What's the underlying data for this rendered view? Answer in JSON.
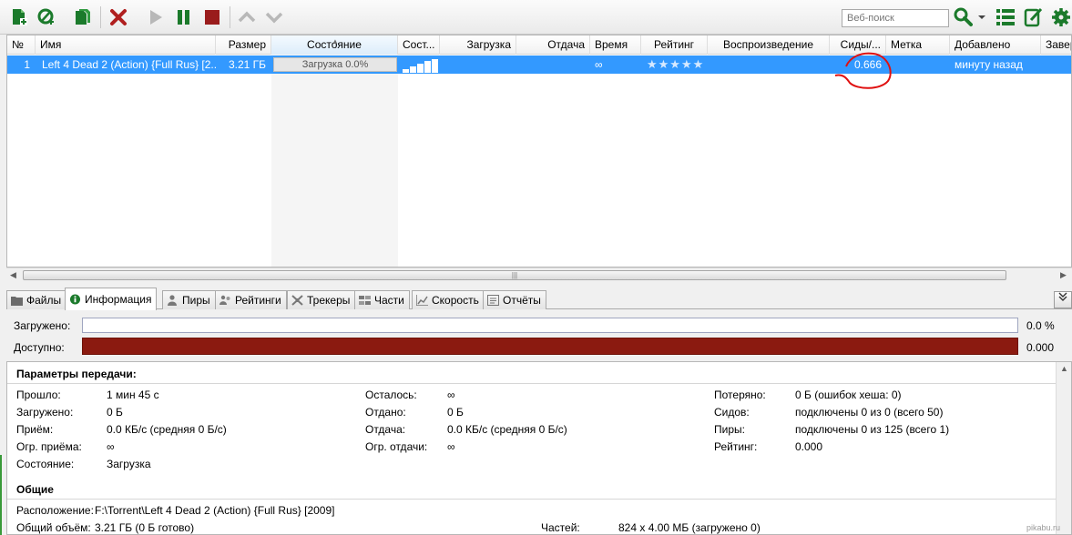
{
  "toolbar": {
    "search_placeholder": "Веб-поиск",
    "icons": [
      "add-torrent-icon",
      "add-link-icon",
      "create-torrent-icon",
      "remove-icon",
      "start-icon",
      "pause-icon",
      "stop-icon",
      "move-up-icon",
      "move-down-icon",
      "search-icon",
      "list-view-icon",
      "rss-icon",
      "settings-icon"
    ],
    "colors": {
      "green": "#1b7a2b",
      "red": "#b01f1f",
      "disabled": "#b8b8b8"
    }
  },
  "list": {
    "columns": [
      "№",
      "Имя",
      "Размер",
      "Состояние",
      "Сост...",
      "Загрузка",
      "Отдача",
      "Время",
      "Рейтинг",
      "Воспроизведение",
      "Сиды/...",
      "Метка",
      "Добавлено",
      "Завер"
    ],
    "rows": [
      {
        "num": "1",
        "name": "Left 4 Dead 2 (Action) {Full Rus} [2...",
        "size": "3.21 ГБ",
        "status": "Загрузка 0.0%",
        "download": "",
        "upload": "",
        "time": "∞",
        "rating_stars": 5,
        "playback": "",
        "seeds_ratio": "0.666",
        "label": "",
        "added": "минуту назад"
      }
    ],
    "selection_color": "#3399ff"
  },
  "tabs": [
    {
      "label": "Файлы",
      "icon": "folder-icon"
    },
    {
      "label": "Информация",
      "icon": "info-icon",
      "active": true
    },
    {
      "label": "Пиры",
      "icon": "peers-icon"
    },
    {
      "label": "Рейтинги",
      "icon": "ratings-icon"
    },
    {
      "label": "Трекеры",
      "icon": "trackers-icon"
    },
    {
      "label": "Части",
      "icon": "pieces-icon"
    },
    {
      "label": "Скорость",
      "icon": "speed-icon"
    },
    {
      "label": "Отчёты",
      "icon": "log-icon"
    }
  ],
  "info": {
    "downloaded_label": "Загружено:",
    "downloaded_value": "0.0 %",
    "downloaded_fraction": 0.0,
    "available_label": "Доступно:",
    "available_value": "0.000",
    "available_color": "#8b1a10"
  },
  "transfer": {
    "title": "Параметры передачи:",
    "col1": [
      {
        "k": "Прошло:",
        "v": "1 мин 45 с"
      },
      {
        "k": "Загружено:",
        "v": "0 Б"
      },
      {
        "k": "Приём:",
        "v": "0.0 КБ/с (средняя 0 Б/с)"
      },
      {
        "k": "Огр. приёма:",
        "v": "∞"
      },
      {
        "k": "Состояние:",
        "v": "Загрузка"
      }
    ],
    "col2": [
      {
        "k": "Осталось:",
        "v": "∞"
      },
      {
        "k": "Отдано:",
        "v": "0 Б"
      },
      {
        "k": "Отдача:",
        "v": "0.0 КБ/с (средняя 0 Б/с)"
      },
      {
        "k": "Огр. отдачи:",
        "v": "∞"
      }
    ],
    "col3": [
      {
        "k": "Потеряно:",
        "v": "0 Б (ошибок хеша: 0)"
      },
      {
        "k": "Сидов:",
        "v": "подключены 0 из 0 (всего 50)"
      },
      {
        "k": "Пиры:",
        "v": "подключены 0 из 125 (всего 1)"
      },
      {
        "k": "Рейтинг:",
        "v": "0.000"
      }
    ]
  },
  "general": {
    "title": "Общие",
    "location_label": "Расположение:",
    "location_value": "F:\\Torrent\\Left 4 Dead 2 (Action) {Full Rus} [2009]",
    "total_label": "Общий объём:",
    "total_value": "3.21 ГБ (0 Б готово)",
    "pieces_label": "Частей:",
    "pieces_value": "824 x 4.00 МБ (загружено 0)"
  },
  "watermark": "pikabu.ru",
  "annotation_color": "#e01010"
}
